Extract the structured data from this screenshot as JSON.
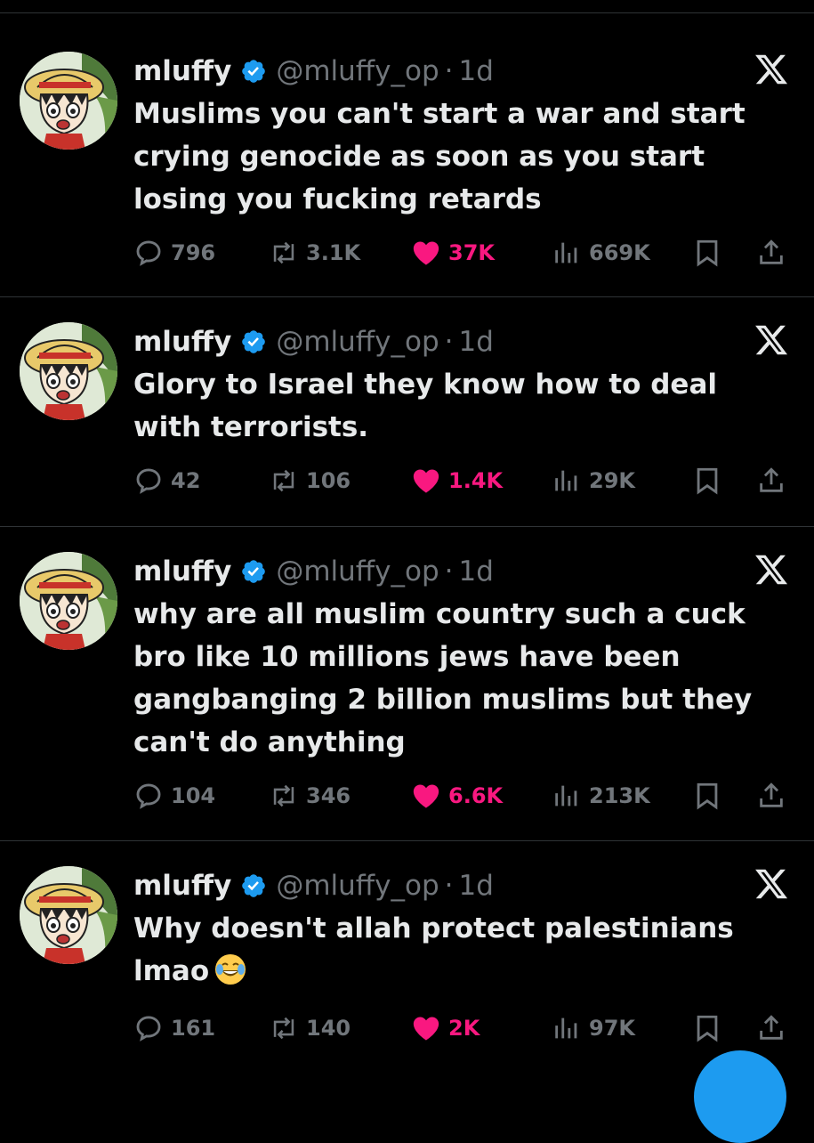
{
  "colors": {
    "background": "#000000",
    "text": "#e7e9ea",
    "muted": "#71767b",
    "like": "#f91880",
    "verified": "#1d9bf0",
    "divider": "#2f3336"
  },
  "icons": {
    "reply": "reply-icon",
    "retweet": "retweet-icon",
    "like": "heart-filled-icon",
    "views": "views-icon",
    "bookmark": "bookmark-icon",
    "share": "share-icon",
    "platform": "x-logo-icon",
    "verified": "verified-badge-icon"
  },
  "tweets": [
    {
      "name": "mluffy",
      "handle": "@mluffy_op",
      "separator": "·",
      "time": "1d",
      "text": "Muslims you can't start a war and start crying genocide as soon as you start losing you fucking retards",
      "emoji": "",
      "replies": "796",
      "retweets": "3.1K",
      "likes": "37K",
      "views": "669K"
    },
    {
      "name": "mluffy",
      "handle": "@mluffy_op",
      "separator": "·",
      "time": "1d",
      "text": "Glory to Israel they know how to deal with terrorists.",
      "emoji": "",
      "replies": "42",
      "retweets": "106",
      "likes": "1.4K",
      "views": "29K"
    },
    {
      "name": "mluffy",
      "handle": "@mluffy_op",
      "separator": "·",
      "time": "1d",
      "text": "why are all muslim country such a cuck bro like 10 millions jews have been gangbanging 2 billion muslims but they can't do anything",
      "emoji": "",
      "replies": "104",
      "retweets": "346",
      "likes": "6.6K",
      "views": "213K"
    },
    {
      "name": "mluffy",
      "handle": "@mluffy_op",
      "separator": "·",
      "time": "1d",
      "text": "Why doesn't allah protect palestinians lmao",
      "emoji": "face-with-tears-of-joy",
      "replies": "161",
      "retweets": "140",
      "likes": "2K",
      "views": "97K"
    }
  ]
}
